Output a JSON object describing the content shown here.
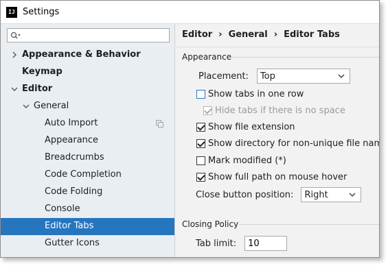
{
  "window": {
    "title": "Settings",
    "app_icon_text": "IJ"
  },
  "search": {
    "value": "",
    "placeholder": ""
  },
  "tree": [
    {
      "label": "Appearance & Behavior",
      "bold": true,
      "arrow": "right",
      "level": 0
    },
    {
      "label": "Keymap",
      "bold": true,
      "arrow": "none",
      "level": 0
    },
    {
      "label": "Editor",
      "bold": true,
      "arrow": "down",
      "level": 0
    },
    {
      "label": "General",
      "bold": false,
      "arrow": "down",
      "level": 1
    },
    {
      "label": "Auto Import",
      "bold": false,
      "arrow": "none",
      "level": 2,
      "copy_icon": true
    },
    {
      "label": "Appearance",
      "bold": false,
      "arrow": "none",
      "level": 2
    },
    {
      "label": "Breadcrumbs",
      "bold": false,
      "arrow": "none",
      "level": 2
    },
    {
      "label": "Code Completion",
      "bold": false,
      "arrow": "none",
      "level": 2
    },
    {
      "label": "Code Folding",
      "bold": false,
      "arrow": "none",
      "level": 2
    },
    {
      "label": "Console",
      "bold": false,
      "arrow": "none",
      "level": 2
    },
    {
      "label": "Editor Tabs",
      "bold": false,
      "arrow": "none",
      "level": 2,
      "selected": true
    },
    {
      "label": "Gutter Icons",
      "bold": false,
      "arrow": "none",
      "level": 2
    }
  ],
  "breadcrumb": {
    "items": [
      "Editor",
      "General",
      "Editor Tabs"
    ],
    "separator": "›"
  },
  "appearance_group": {
    "title": "Appearance",
    "placement_label": "Placement:",
    "placement_value": "Top",
    "options": [
      {
        "label": "Show tabs in one row",
        "checked": false,
        "disabled": false,
        "focused": true
      },
      {
        "label": "Hide tabs if there is no space",
        "checked": true,
        "disabled": true
      },
      {
        "label": "Show file extension",
        "checked": true,
        "disabled": false
      },
      {
        "label": "Show directory for non-unique file names",
        "checked": true,
        "disabled": false
      },
      {
        "label": "Mark modified (*)",
        "checked": false,
        "disabled": false
      },
      {
        "label": "Show full path on mouse hover",
        "checked": true,
        "disabled": false
      }
    ],
    "close_button_label": "Close button position:",
    "close_button_value": "Right"
  },
  "closing_group": {
    "title": "Closing Policy",
    "tab_limit_label": "Tab limit:",
    "tab_limit_value": "10"
  },
  "colors": {
    "selection": "#2675bf",
    "sidebar_bg": "#e9eef3",
    "panel_bg": "#f2f2f2"
  }
}
